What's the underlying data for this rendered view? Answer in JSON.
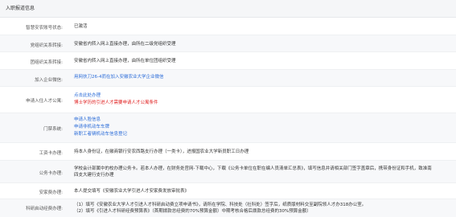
{
  "header": {
    "title": "入职报道信息"
  },
  "rows": [
    {
      "label": "智慧安农账号状态:",
      "value": "已激活"
    },
    {
      "label": "党组织关系转接:",
      "value": "安徽省内转入网上直接办理，由所在二级党组织受理"
    },
    {
      "label": "团组织关系转接:",
      "value": "安徽省内转入网上直接办理，由所在单位团组织受理"
    },
    {
      "label": "加入企业微信:",
      "link": "用网扶刀26-4而在加入安徽农业大学企业微信"
    },
    {
      "label": "申请入住人才公寓:",
      "link": "点击此处办理",
      "note": "博士学历的引进人才需要申请人才公寓条件"
    },
    {
      "label": "门禁系统:",
      "links": [
        "申请人脸信息",
        "申请非机动车车牌",
        "新职工者辆机动车信息登记"
      ]
    },
    {
      "label": "工资卡办理:",
      "value": "持本人身份证，在徽商银行安农西路支行办理（一类卡），进报国农业大学新员职工日办理"
    },
    {
      "label": "公务卡办理:",
      "lines": [
        "学校会计部属中的校办理公务卡。若本人办理，在财务处官网-下载中心，下载《公务卡单位在职在编人员清单汇总表》，填写信息并请相关部门签字盖章后，携带身份证和手机，致准南",
        "四支大建行支行办理"
      ]
    },
    {
      "label": "安家费办理:",
      "value": "本人提交填写《安徽农业大学引进人才安家费发放审批表》"
    },
    {
      "label": "科研启动经费办理:",
      "lines": [
        "（1）填写《安徽农业大学人才引进人才科研启动费立项申请书》，请所在学院、科技处（社科处）签字后，纸质版材料交至副院领人才办318办公室。",
        "（2）填写《引进人才科研经费预算表》（首期拨款总经费的70%预算金额）中期考核合格后拨款总经费的30%预算金额）"
      ]
    }
  ]
}
